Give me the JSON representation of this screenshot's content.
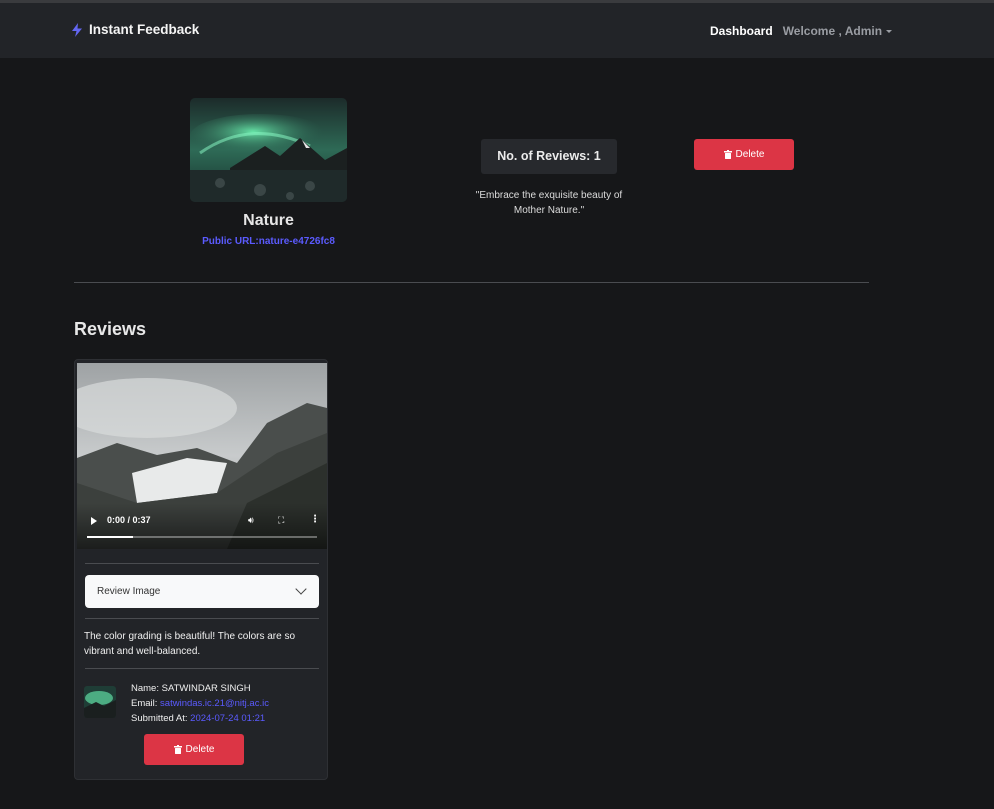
{
  "navbar": {
    "brand": "Instant Feedback",
    "dashboard_label": "Dashboard",
    "welcome_label": "Welcome , Admin"
  },
  "space": {
    "title": "Nature",
    "public_url": "Public URL:nature-e4726fc8",
    "reviews_count": "No. of Reviews: 1",
    "quote": "\"Embrace the exquisite beauty of Mother Nature.\"",
    "delete_label": "Delete"
  },
  "reviews_section": {
    "heading": "Reviews",
    "items": [
      {
        "video_time": "0:00 / 0:37",
        "video_progress_fraction": 0.2,
        "accordion_label": "Review Image",
        "text": "The color grading is beautiful! The colors are so vibrant and well-balanced.",
        "name_label": "Name:",
        "name": "SATWINDAR SINGH",
        "email_label": "Email:",
        "email": "satwindas.ic.21@nitj.ac.ic",
        "submitted_label": "Submitted At:",
        "submitted_at": "2024-07-24 01:21",
        "delete_label": "Delete"
      }
    ]
  },
  "colors": {
    "background": "#161719",
    "navbar": "#222428",
    "danger": "#dc3545",
    "link": "#5b5bff"
  }
}
